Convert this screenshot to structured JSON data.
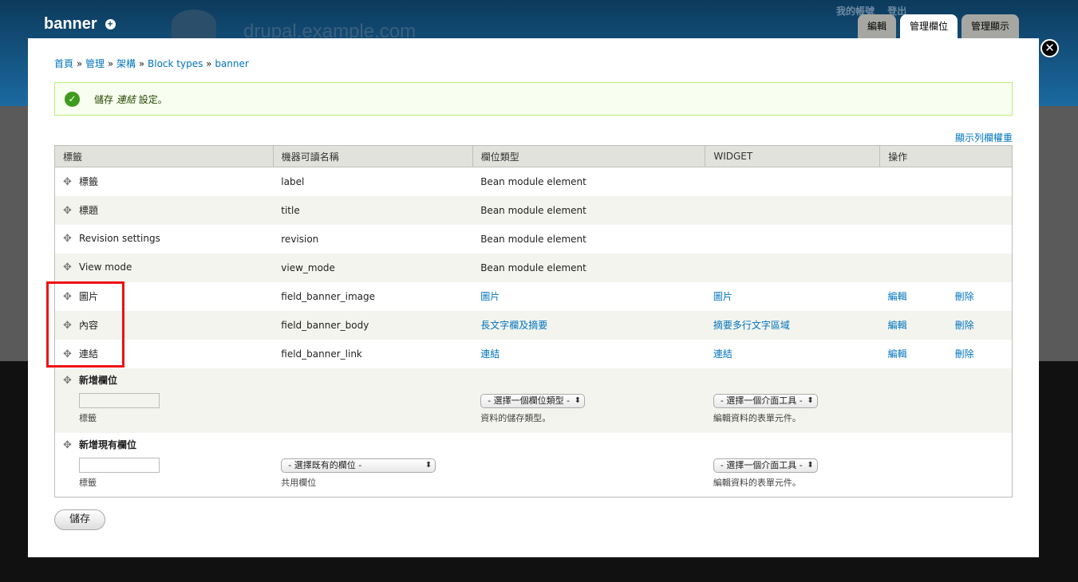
{
  "background": {
    "site_name": "drupal.example.com",
    "user_links": [
      "我的帳號",
      "登出"
    ]
  },
  "overlay": {
    "title": "banner",
    "tabs": [
      {
        "label": "編輯",
        "active": false
      },
      {
        "label": "管理欄位",
        "active": true
      },
      {
        "label": "管理顯示",
        "active": false
      }
    ],
    "close_icon": "✕"
  },
  "breadcrumb": [
    "首頁",
    "管理",
    "架構",
    "Block types",
    "banner"
  ],
  "message": {
    "before": "儲存",
    "emph": "連結",
    "after": "設定。"
  },
  "show_weights_link": "顯示列欄權重",
  "table": {
    "headers": [
      "標籤",
      "機器可讀名稱",
      "欄位類型",
      "WIDGET",
      "操作"
    ],
    "rows": [
      {
        "label": "標籤",
        "machine": "label",
        "type": "Bean module element",
        "widget": "",
        "edit": "",
        "delete": ""
      },
      {
        "label": "標題",
        "machine": "title",
        "type": "Bean module element",
        "widget": "",
        "edit": "",
        "delete": ""
      },
      {
        "label": "Revision settings",
        "machine": "revision",
        "type": "Bean module element",
        "widget": "",
        "edit": "",
        "delete": ""
      },
      {
        "label": "View mode",
        "machine": "view_mode",
        "type": "Bean module element",
        "widget": "",
        "edit": "",
        "delete": ""
      },
      {
        "label": "圖片",
        "machine": "field_banner_image",
        "type": "圖片",
        "widget": "圖片",
        "edit": "編輯",
        "delete": "刪除"
      },
      {
        "label": "內容",
        "machine": "field_banner_body",
        "type": "長文字欄及摘要",
        "widget": "摘要多行文字區域",
        "edit": "編輯",
        "delete": "刪除"
      },
      {
        "label": "連結",
        "machine": "field_banner_link",
        "type": "連結",
        "widget": "連結",
        "edit": "編輯",
        "delete": "刪除"
      }
    ],
    "add_new": {
      "title": "新增欄位",
      "label_desc": "標籤",
      "type_select": "- 選擇一個欄位類型 -",
      "type_desc": "資料的儲存類型。",
      "widget_select": "- 選擇一個介面工具 -",
      "widget_desc": "編輯資料的表單元件。"
    },
    "add_existing": {
      "title": "新增現有欄位",
      "label_desc": "標籤",
      "field_select": "- 選擇既有的欄位 -",
      "field_desc": "共用欄位",
      "widget_select": "- 選擇一個介面工具 -",
      "widget_desc": "編輯資料的表單元件。"
    }
  },
  "save_button": "儲存",
  "colors": {
    "link": "#0074bd",
    "highlight": "#ee1111",
    "header_bg": "#1b6aa1"
  }
}
